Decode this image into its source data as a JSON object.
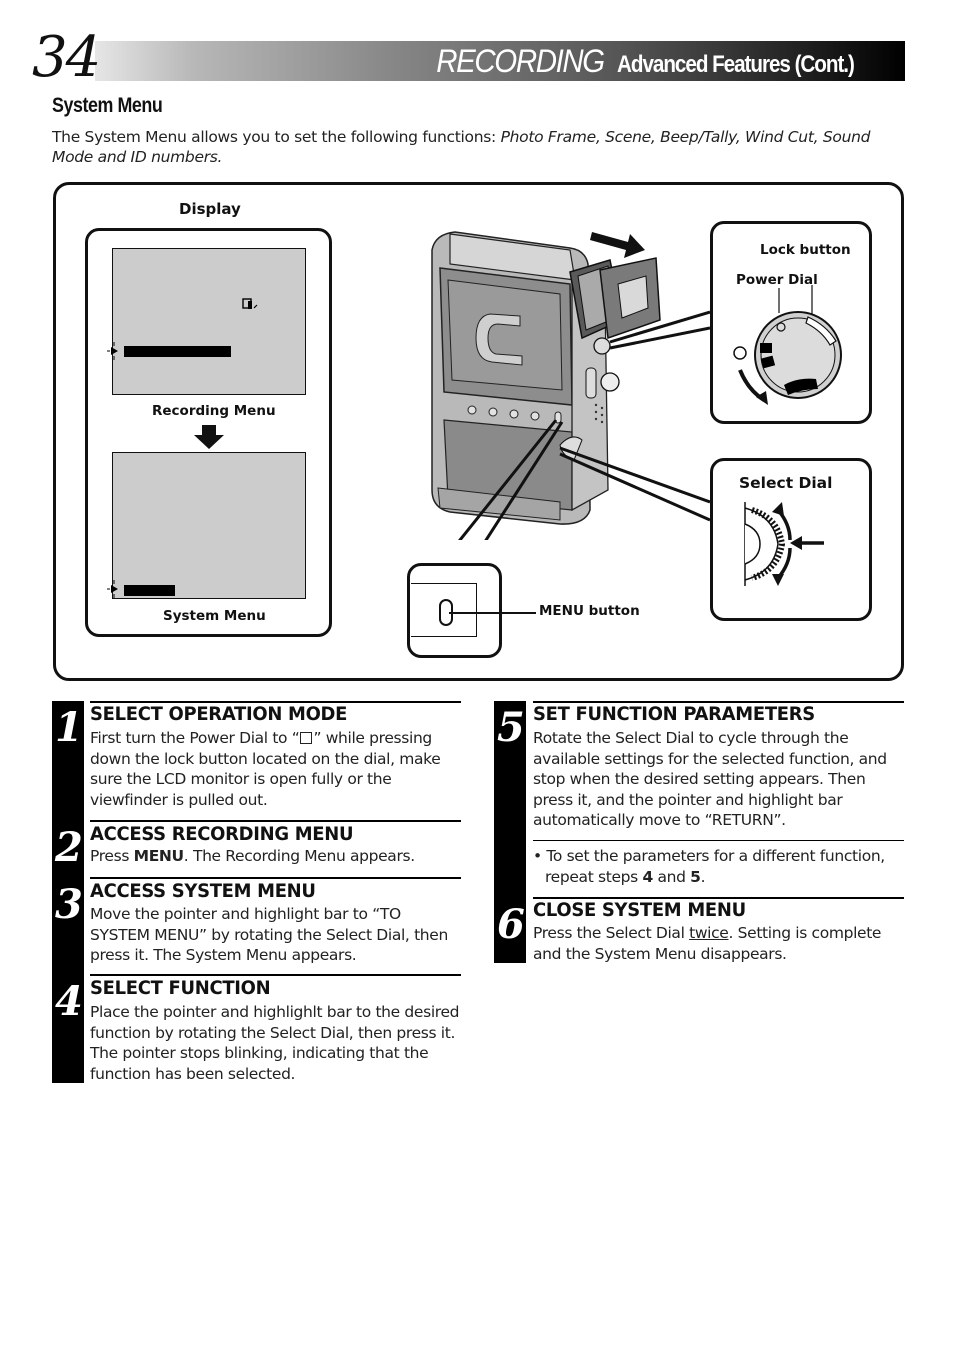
{
  "header": {
    "page_number": "34",
    "title_main": "RECORDING",
    "title_sub": "Advanced Features (Cont.)"
  },
  "section": {
    "title": "System Menu",
    "intro_plain": "The System Menu allows you to set the following functions: ",
    "intro_italic": "Photo Frame, Scene, Beep/Tally, Wind Cut, Sound Mode and ID numbers."
  },
  "diagram": {
    "display_label": "Display",
    "recording_menu_label": "Recording Menu",
    "system_menu_label": "System Menu",
    "lock_button_label": "Lock button",
    "power_dial_label": "Power Dial",
    "select_dial_label": "Select Dial",
    "menu_button_label": "MENU button"
  },
  "steps": [
    {
      "number": "1",
      "heading": "SELECT OPERATION MODE",
      "body_pre": "First turn the Power Dial to “",
      "body_post": "” while pressing down the lock button located on the dial, make sure the LCD monitor is open fully or the viewfinder is pulled out."
    },
    {
      "number": "2",
      "heading": "ACCESS RECORDING MENU",
      "body_pre": "Press ",
      "body_bold": "MENU",
      "body_post": ". The Recording Menu appears."
    },
    {
      "number": "3",
      "heading": "ACCESS SYSTEM MENU",
      "body": "Move the pointer and highlight bar to “TO SYSTEM MENU” by rotating the Select Dial, then press it. The System Menu appears."
    },
    {
      "number": "4",
      "heading": "SELECT FUNCTION",
      "body": "Place the pointer and highlighlt bar to the desired function by rotating the Select Dial, then press it. The pointer stops blinking, indicating that the function has been selected."
    },
    {
      "number": "5",
      "heading": "SET FUNCTION PARAMETERS",
      "body": "Rotate the Select Dial to cycle through the available settings for the selected function, and stop when the desired setting appears. Then press it, and the pointer and highlight bar automatically move to “RETURN”.",
      "note_pre": "To set the parameters for a different function, repeat steps ",
      "note_b1": "4",
      "note_mid": " and ",
      "note_b2": "5",
      "note_post": "."
    },
    {
      "number": "6",
      "heading": "CLOSE SYSTEM MENU",
      "body_pre": "Press the Select Dial ",
      "body_underline": "twice",
      "body_post": ". Setting is complete and the System Menu disappears."
    }
  ]
}
